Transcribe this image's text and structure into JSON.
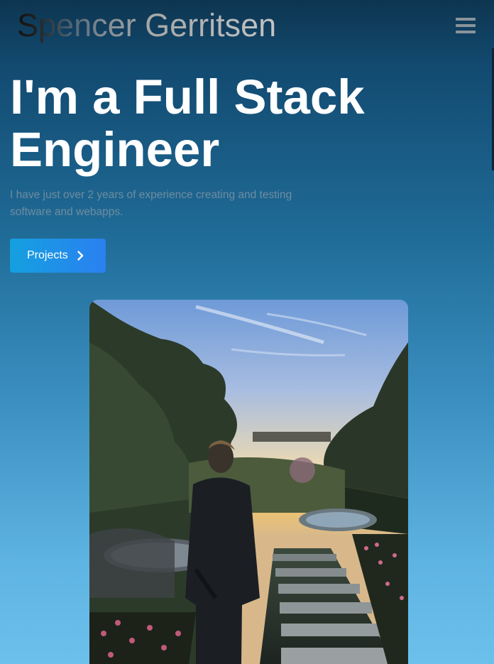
{
  "header": {
    "logo_text": "Spencer Gerritsen",
    "menu_icon": "hamburger-menu-icon"
  },
  "hero": {
    "title": "I'm a Full Stack Engineer",
    "subtitle": "I have just over 2 years of experience creating and testing software and webapps.",
    "projects_button_label": "Projects",
    "projects_button_icon": "chevron-right-icon"
  },
  "colors": {
    "button_gradient_start": "#14a0e0",
    "button_gradient_end": "#2b80f0",
    "subtitle_text": "#6f8c9f"
  }
}
